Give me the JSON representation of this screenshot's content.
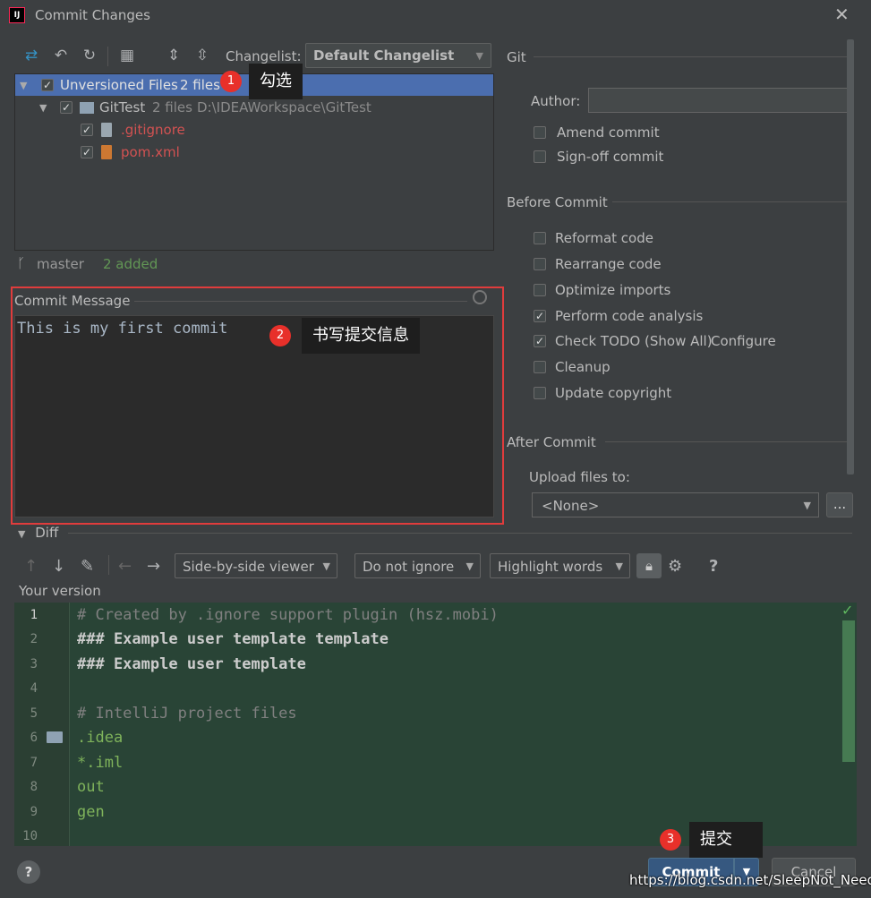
{
  "window": {
    "title": "Commit Changes",
    "app_icon": "IJ"
  },
  "changelist": {
    "label": "Changelist:",
    "value": "Default Changelist"
  },
  "tree": {
    "root": {
      "label": "Unversioned Files",
      "count": "2 files"
    },
    "project": {
      "label": "GitTest",
      "count": "2 files",
      "path": "D:\\IDEAWorkspace\\GitTest"
    },
    "files": [
      {
        "name": ".gitignore"
      },
      {
        "name": "pom.xml"
      }
    ]
  },
  "status": {
    "branch": "master",
    "added": "2 added"
  },
  "commit_message": {
    "title": "Commit Message",
    "text": "This is my first commit"
  },
  "annotations": [
    {
      "number": "1",
      "text": "勾选"
    },
    {
      "number": "2",
      "text": "书写提交信息"
    },
    {
      "number": "3",
      "text": "提交"
    }
  ],
  "git": {
    "title": "Git",
    "author_label": "Author:",
    "amend": "Amend commit",
    "signoff": "Sign-off commit"
  },
  "before_commit": {
    "title": "Before Commit",
    "options": [
      {
        "label": "Reformat code",
        "checked": false
      },
      {
        "label": "Rearrange code",
        "checked": false
      },
      {
        "label": "Optimize imports",
        "checked": false
      },
      {
        "label": "Perform code analysis",
        "checked": true
      },
      {
        "label": "Check TODO (Show All)",
        "checked": true
      },
      {
        "label": "Cleanup",
        "checked": false
      },
      {
        "label": "Update copyright",
        "checked": false
      }
    ],
    "configure_link": "Configure"
  },
  "after_commit": {
    "title": "After Commit",
    "upload_label": "Upload files to:",
    "upload_value": "<None>",
    "dots": "..."
  },
  "diff": {
    "title": "Diff",
    "viewer": "Side-by-side viewer",
    "ignore": "Do not ignore",
    "highlight": "Highlight words",
    "help": "?",
    "your_version": "Your version",
    "lines": [
      {
        "n": "1",
        "text": "# Created by .ignore support plugin (hsz.mobi)"
      },
      {
        "n": "2",
        "text": "### Example user template template"
      },
      {
        "n": "3",
        "text": "### Example user template"
      },
      {
        "n": "4",
        "text": ""
      },
      {
        "n": "5",
        "text": "# IntelliJ project files"
      },
      {
        "n": "6",
        "text": ".idea"
      },
      {
        "n": "7",
        "text": "*.iml"
      },
      {
        "n": "8",
        "text": "out"
      },
      {
        "n": "9",
        "text": "gen"
      },
      {
        "n": "10",
        "text": ""
      }
    ]
  },
  "footer": {
    "help": "?",
    "commit": "Commit",
    "cancel": "Cancel"
  },
  "watermark": "https://blog.csdn.net/SleepNot_Need",
  "colors": {
    "accent": "#4b6eaf",
    "commit_button": "#365880",
    "annotation_badge": "#e8302a",
    "highlight_frame": "#e03c3c"
  }
}
